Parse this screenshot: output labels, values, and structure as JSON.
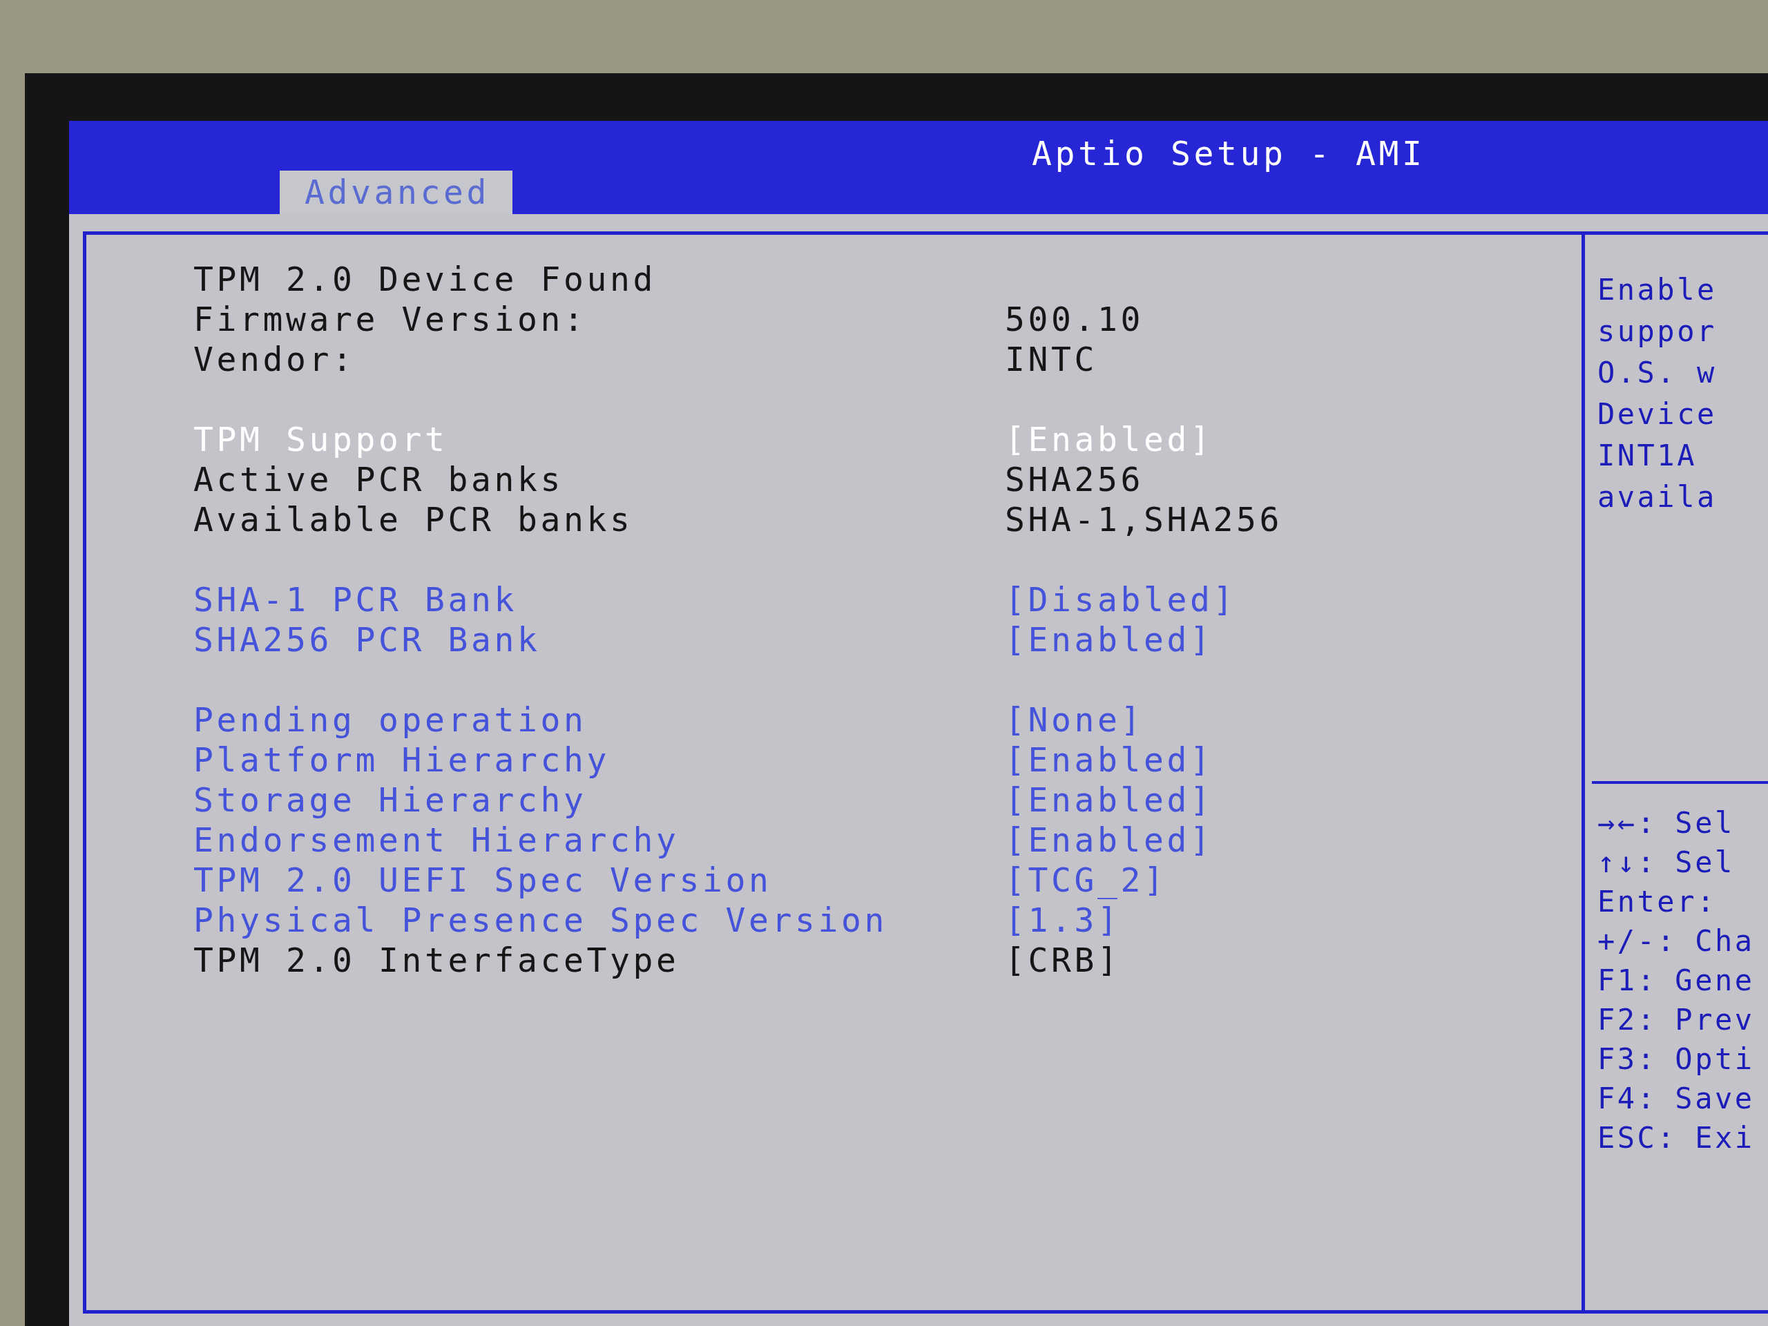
{
  "screen": {
    "title": "Aptio Setup - AMI",
    "tabs": [
      {
        "label": "Advanced",
        "selected": true
      }
    ]
  },
  "settings": {
    "groups": [
      {
        "rows": [
          {
            "kind": "info",
            "label": "TPM 2.0 Device Found",
            "selected": false
          },
          {
            "kind": "info",
            "label": "Firmware Version:",
            "value": "500.10",
            "selected": false
          },
          {
            "kind": "info",
            "label": "Vendor:",
            "value": "INTC",
            "selected": false
          }
        ]
      },
      {
        "rows": [
          {
            "kind": "option",
            "label": "TPM Support",
            "value": "[Enabled]",
            "selected": true
          },
          {
            "kind": "info",
            "label": "Active PCR banks",
            "value": "SHA256",
            "selected": false
          },
          {
            "kind": "info",
            "label": "Available PCR banks",
            "value": "SHA-1,SHA256",
            "selected": false
          }
        ]
      },
      {
        "rows": [
          {
            "kind": "option",
            "label": "SHA-1 PCR Bank",
            "value": "[Disabled]",
            "selected": false
          },
          {
            "kind": "option",
            "label": "SHA256 PCR Bank",
            "value": "[Enabled]",
            "selected": false
          }
        ]
      },
      {
        "rows": [
          {
            "kind": "option",
            "label": "Pending operation",
            "value": "[None]",
            "selected": false
          },
          {
            "kind": "option",
            "label": "Platform Hierarchy",
            "value": "[Enabled]",
            "selected": false
          },
          {
            "kind": "option",
            "label": "Storage Hierarchy",
            "value": "[Enabled]",
            "selected": false
          },
          {
            "kind": "option",
            "label": "Endorsement Hierarchy",
            "value": "[Enabled]",
            "selected": false
          },
          {
            "kind": "option",
            "label": "TPM 2.0 UEFI Spec Version",
            "value": "[TCG_2]",
            "selected": false
          },
          {
            "kind": "option",
            "label": "Physical Presence Spec Version",
            "value": "[1.3]",
            "selected": false
          },
          {
            "kind": "info",
            "label": "TPM 2.0 InterfaceType",
            "value": "[CRB]",
            "selected": false
          }
        ]
      }
    ]
  },
  "help": {
    "lines": [
      "Enable",
      "suppor",
      "O.S. w",
      "Device",
      "INT1A",
      "availa"
    ]
  },
  "key_hints": [
    {
      "key": "→←:",
      "action": "Sel"
    },
    {
      "key": "↑↓:",
      "action": "Sel"
    },
    {
      "key": "Enter:"
    },
    {
      "key": "+/-:",
      "action": "Cha"
    },
    {
      "key": "F1:",
      "action": "Gene"
    },
    {
      "key": "F2:",
      "action": "Prev"
    },
    {
      "key": "F3:",
      "action": "Opti"
    },
    {
      "key": "F4:",
      "action": "Save"
    },
    {
      "key": "ESC:",
      "action": "Exi"
    }
  ]
}
